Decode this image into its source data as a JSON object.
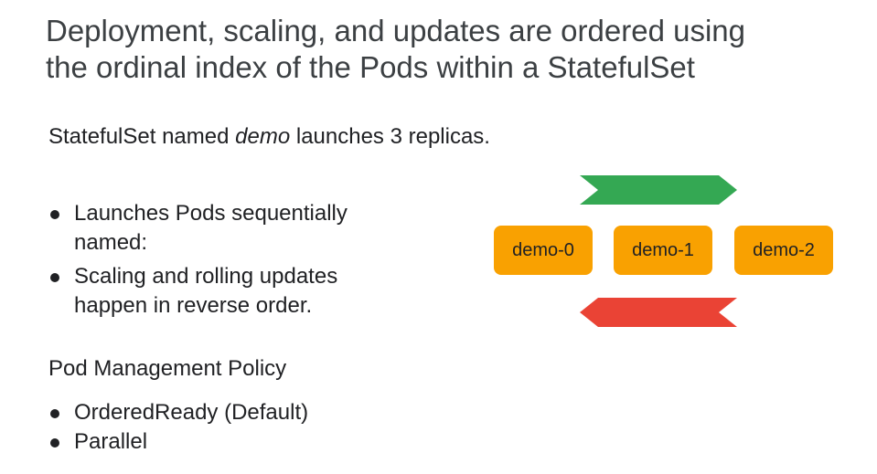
{
  "title": {
    "line1": "Deployment, scaling, and updates are ordered using",
    "line2": "the ordinal index of the Pods within a StatefulSet"
  },
  "subtitle": {
    "prefix": "StatefulSet named ",
    "emphasis": "demo",
    "suffix": " launches 3 replicas."
  },
  "bullets": [
    {
      "text": "Launches Pods sequentially named:"
    },
    {
      "text": "Scaling and rolling updates happen in reverse order."
    }
  ],
  "policy": {
    "heading": "Pod Management Policy",
    "items": [
      {
        "text": "OrderedReady (Default)"
      },
      {
        "text": "Parallel"
      }
    ]
  },
  "pods": [
    {
      "label": "demo-0"
    },
    {
      "label": "demo-1"
    },
    {
      "label": "demo-2"
    }
  ],
  "colors": {
    "pod": "#f9a101",
    "forward_arrow": "#34a853",
    "reverse_arrow": "#ea4335"
  }
}
